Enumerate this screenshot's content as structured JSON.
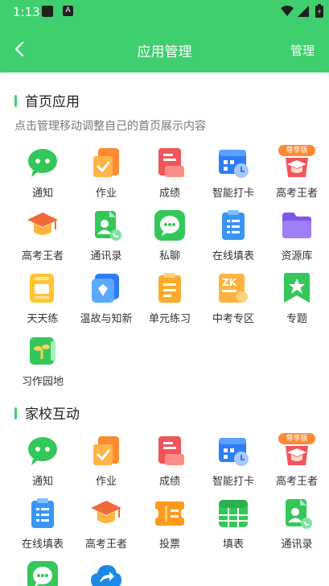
{
  "status": {
    "time": "1:13",
    "notice_glyph": "A"
  },
  "header": {
    "title": "应用管理",
    "manage_label": "管理"
  },
  "sections": [
    {
      "title": "首页应用",
      "subtitle": "点击管理移动调整自己的首页展示内容",
      "items": [
        {
          "label": "通知",
          "icon": "chat-bubble-icon"
        },
        {
          "label": "作业",
          "icon": "homework-icon"
        },
        {
          "label": "成绩",
          "icon": "grade-icon"
        },
        {
          "label": "智能打卡",
          "icon": "calendar-clock-icon"
        },
        {
          "label": "高考王者",
          "icon": "premium-graduation-icon",
          "badge": "尊享版"
        },
        {
          "label": "高考王者",
          "icon": "graduation-cap-icon"
        },
        {
          "label": "通讯录",
          "icon": "contacts-icon"
        },
        {
          "label": "私聊",
          "icon": "private-chat-icon"
        },
        {
          "label": "在线填表",
          "icon": "clipboard-form-icon"
        },
        {
          "label": "资源库",
          "icon": "folder-icon"
        },
        {
          "label": "天天练",
          "icon": "daily-practice-icon"
        },
        {
          "label": "温故与知新",
          "icon": "review-book-icon"
        },
        {
          "label": "单元练习",
          "icon": "unit-exercise-icon"
        },
        {
          "label": "中考专区",
          "icon": "zk-zone-icon"
        },
        {
          "label": "专题",
          "icon": "bookmark-star-icon"
        },
        {
          "label": "习作园地",
          "icon": "writing-garden-icon"
        }
      ]
    },
    {
      "title": "家校互动",
      "items": [
        {
          "label": "通知",
          "icon": "chat-bubble-icon"
        },
        {
          "label": "作业",
          "icon": "homework-icon"
        },
        {
          "label": "成绩",
          "icon": "grade-icon"
        },
        {
          "label": "智能打卡",
          "icon": "calendar-clock-icon"
        },
        {
          "label": "高考王者",
          "icon": "premium-graduation-icon",
          "badge": "尊享版"
        },
        {
          "label": "在线填表",
          "icon": "clipboard-form-icon"
        },
        {
          "label": "高考王者",
          "icon": "graduation-cap-icon"
        },
        {
          "label": "投票",
          "icon": "vote-ticket-icon"
        },
        {
          "label": "填表",
          "icon": "table-form-icon"
        },
        {
          "label": "通讯录",
          "icon": "contacts-icon"
        },
        {
          "label": "",
          "icon": "private-chat-icon"
        },
        {
          "label": "",
          "icon": "cloud-share-icon"
        }
      ]
    }
  ],
  "colors": {
    "accent": "#3fcf6f"
  }
}
